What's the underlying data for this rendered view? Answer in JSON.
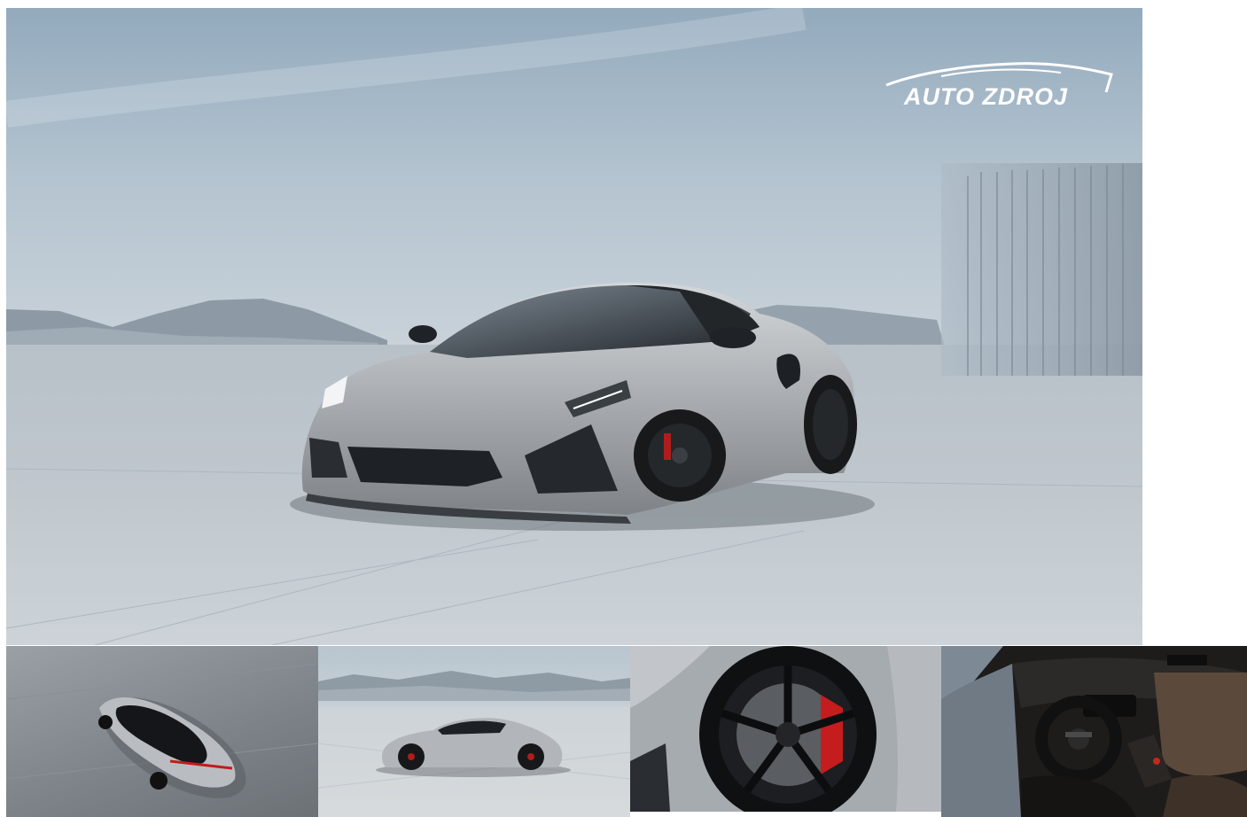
{
  "brand": {
    "name": "AUTO ZDROJ"
  },
  "gallery": {
    "hero": {
      "icon": "sports-car-hero-photo"
    },
    "thumbnails": [
      {
        "icon": "car-top-view-photo"
      },
      {
        "icon": "car-side-view-photo"
      },
      {
        "icon": "wheel-brake-detail-photo"
      },
      {
        "icon": "car-interior-dashboard-photo"
      }
    ]
  }
}
